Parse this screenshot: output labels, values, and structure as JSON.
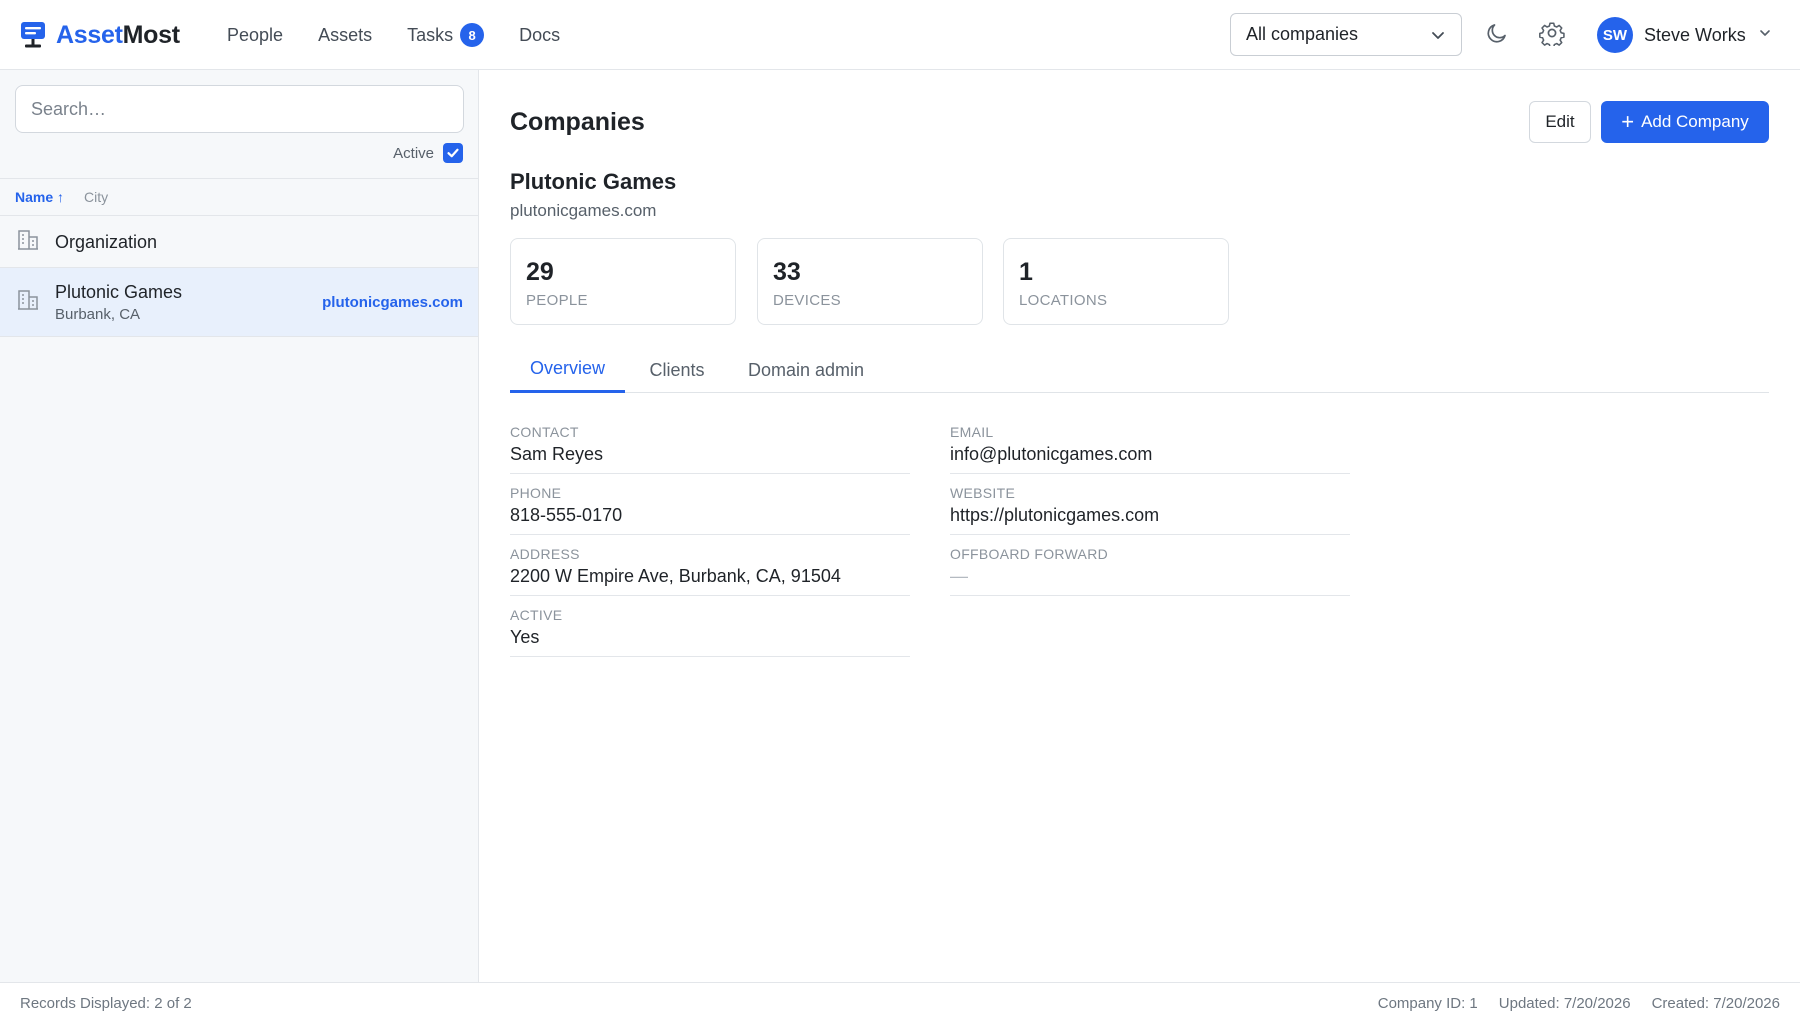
{
  "app": {
    "name_part1": "Asset",
    "name_part2": "Most",
    "accent_color": "#2563eb"
  },
  "nav": {
    "people": "People",
    "assets": "Assets",
    "tasks": "Tasks",
    "tasks_badge": "8",
    "docs": "Docs"
  },
  "header": {
    "company_filter": "All companies",
    "user_initials": "SW",
    "user_name": "Steve Works"
  },
  "sidebar": {
    "search_placeholder": "Search…",
    "active_label": "Active",
    "active_checked": true,
    "columns": {
      "name": "Name ↑",
      "city": "City"
    },
    "rows": [
      {
        "name": "Organization"
      },
      {
        "name": "Plutonic Games",
        "city": "Burbank, CA",
        "domain": "plutonicgames.com",
        "selected": true
      }
    ]
  },
  "main": {
    "title": "Companies",
    "edit_label": "Edit",
    "add_label": "Add Company",
    "company_name": "Plutonic Games",
    "company_domain": "plutonicgames.com",
    "stats": [
      {
        "value": "29",
        "label": "People"
      },
      {
        "value": "33",
        "label": "Devices"
      },
      {
        "value": "1",
        "label": "Locations"
      }
    ],
    "tabs": [
      "Overview",
      "Clients",
      "Domain admin"
    ],
    "active_tab": "Overview",
    "fields_left": [
      {
        "label": "Contact",
        "value": "Sam Reyes"
      },
      {
        "label": "Phone",
        "value": "818-555-0170"
      },
      {
        "label": "Address",
        "value": "2200 W Empire Ave, Burbank, CA, 91504"
      },
      {
        "label": "Active",
        "value": "Yes"
      }
    ],
    "fields_right": [
      {
        "label": "Email",
        "value": "info@plutonicgames.com"
      },
      {
        "label": "Website",
        "value": "https://plutonicgames.com"
      },
      {
        "label": "Offboard Forward",
        "value": "—"
      }
    ]
  },
  "footer": {
    "records": "Records Displayed: 2 of 2",
    "company_id": "Company ID: 1",
    "updated": "Updated: 7/20/2026",
    "created": "Created: 7/20/2026"
  }
}
